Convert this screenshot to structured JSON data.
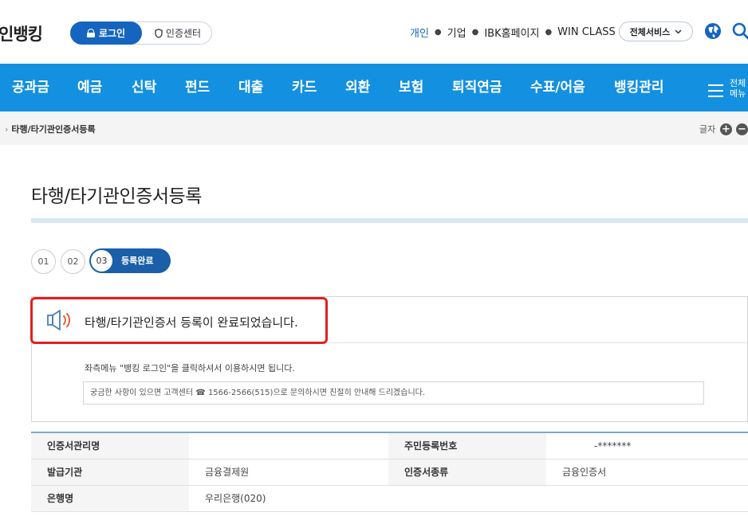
{
  "header": {
    "brand": "인뱅킹",
    "login_label": "로그인",
    "cert_center_label": "인증센터",
    "top_links": [
      "개인",
      "기업",
      "IBK홈페이지",
      "WIN CLASS"
    ],
    "all_services_label": "전체서비스"
  },
  "nav": {
    "items": [
      "공과금",
      "예금",
      "신탁",
      "펀드",
      "대출",
      "카드",
      "외환",
      "보험",
      "퇴직연금",
      "수표/어음",
      "뱅킹관리"
    ],
    "menu_all_label_1": "전체",
    "menu_all_label_2": "메뉴"
  },
  "breadcrumb": {
    "current": "타행/타기관인증서등록",
    "font_size_label": "글자",
    "zoom_in": "+",
    "zoom_out": "−"
  },
  "page": {
    "title": "타행/타기관인증서등록",
    "steps": [
      "01",
      "02"
    ],
    "active_step_num": "03",
    "active_step_label": "등록완료"
  },
  "complete": {
    "message": "타행/타기관인증서 등록이 완료되었습니다.",
    "guide": "좌측메뉴 \"뱅킹 로그인\"을 클릭하셔서 이용하시면 됩니다.",
    "inquiry": "궁금한 사항이 있으면 고객센터 ☎ 1566-2566(515)으로 문의하시면 친절히 안내해 드리겠습니다."
  },
  "info_table": {
    "rows": [
      {
        "label1": "인증서관리명",
        "value1": "",
        "label2": "주민등록번호",
        "value2": "-*******"
      },
      {
        "label1": "발급기관",
        "value1": "금융결제원",
        "label2": "인증서종류",
        "value2": "금융인증서"
      },
      {
        "label1": "은행명",
        "value1": "우리은행(020)",
        "label2": "",
        "value2": ""
      }
    ]
  },
  "colors": {
    "nav_bg": "#1490e0",
    "primary": "#1565c0",
    "highlight_border": "#e02020"
  }
}
